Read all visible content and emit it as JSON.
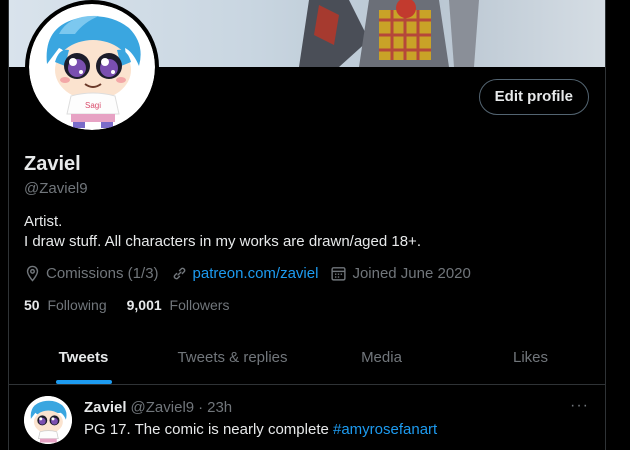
{
  "profile": {
    "name": "Zaviel",
    "handle": "@Zaviel9",
    "bio_line1": "Artist.",
    "bio_line2": "I draw stuff. All characters in my works are drawn/aged 18+.",
    "location": "Comissions (1/3)",
    "link": "patreon.com/zaviel",
    "joined": "Joined June 2020",
    "following_count": "50",
    "following_label": "Following",
    "followers_count": "9,001",
    "followers_label": "Followers",
    "edit_label": "Edit profile",
    "avatar_shirt_text": "Sagi"
  },
  "tabs": [
    {
      "label": "Tweets",
      "active": true
    },
    {
      "label": "Tweets & replies",
      "active": false
    },
    {
      "label": "Media",
      "active": false
    },
    {
      "label": "Likes",
      "active": false
    }
  ],
  "tweet": {
    "name": "Zaviel",
    "handle": "@Zaviel9",
    "sep": "·",
    "time": "23h",
    "text": "PG 17. The comic is nearly complete ",
    "hashtag": "#amyrosefanart",
    "more": "···"
  },
  "colors": {
    "accent": "#1d9bf0",
    "background": "#000000",
    "muted": "#71767b"
  }
}
